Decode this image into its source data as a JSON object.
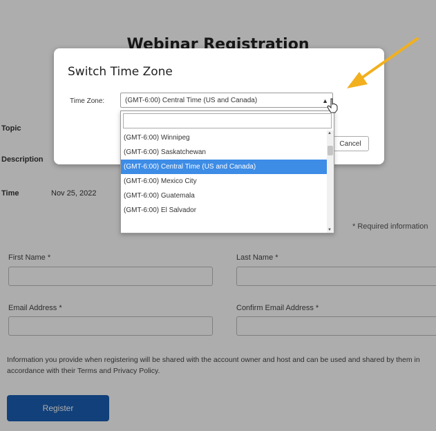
{
  "page": {
    "title": "Webinar Registration",
    "topic_label": "Topic",
    "description_label": "Description",
    "time_label": "Time",
    "time_value": "Nov 25, 2022 ",
    "required_note": "* Required information",
    "first_name_label": "First Name *",
    "last_name_label": "Last Name *",
    "email_label": "Email Address *",
    "confirm_email_label": "Confirm Email Address *",
    "disclaimer": "Information you provide when registering will be shared with the account owner and host and can be used and shared by them in accordance with their Terms and Privacy Policy.",
    "register_label": "Register"
  },
  "modal": {
    "title": "Switch Time Zone",
    "tz_label": "Time Zone:",
    "selected_value": "(GMT-6:00) Central Time (US and Canada)",
    "cancel_label": "Cancel",
    "search_placeholder": ""
  },
  "dropdown": {
    "options": [
      "(GMT-6:00) Winnipeg",
      "(GMT-6:00) Saskatchewan",
      "(GMT-6:00) Central Time (US and Canada)",
      "(GMT-6:00) Mexico City",
      "(GMT-6:00) Guatemala",
      "(GMT-6:00) El Salvador"
    ],
    "selected_index": 2
  },
  "colors": {
    "accent": "#1a5fb4",
    "selected_option": "#3d8ce6",
    "annotation_arrow": "#f2b01e"
  },
  "icons": {
    "select_caret": "chevron-down-icon",
    "cursor": "hand-pointer-icon",
    "annotation": "arrow-annotation"
  }
}
